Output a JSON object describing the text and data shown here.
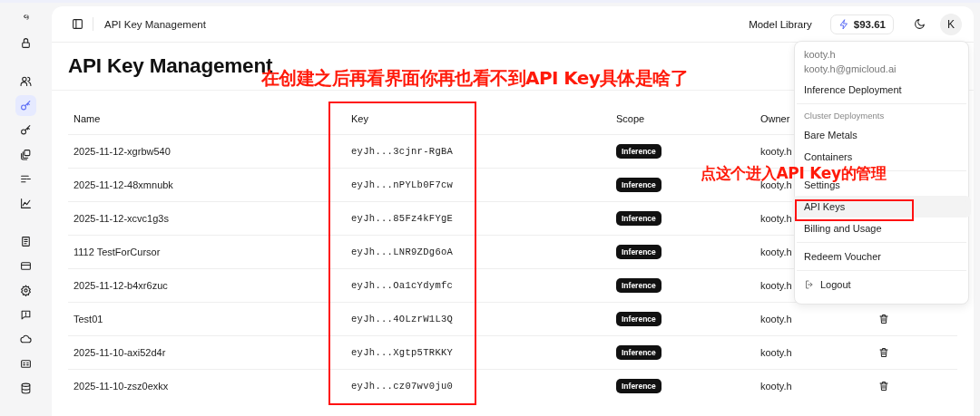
{
  "sidebar": {
    "groups": [
      {
        "items": [
          {
            "selected": false
          }
        ]
      },
      {
        "items": [
          {
            "selected": false
          },
          {
            "selected": true
          },
          {
            "selected": false
          },
          {
            "selected": false
          },
          {
            "selected": false
          },
          {
            "selected": false
          }
        ]
      },
      {
        "items": [
          {
            "selected": false
          },
          {
            "selected": false
          },
          {
            "selected": false
          },
          {
            "selected": false
          },
          {
            "selected": false
          },
          {
            "selected": false
          },
          {
            "selected": false
          }
        ]
      }
    ]
  },
  "header": {
    "title": "API Key Management",
    "link": "Model Library",
    "balance": "$93.61",
    "avatar": "K"
  },
  "page_title": "API Key Management",
  "table": {
    "columns": [
      "Name",
      "Key",
      "Scope",
      "Owner"
    ],
    "rows": [
      {
        "name": "2025-11-12-xgrbw540",
        "key": "eyJh...3cjnr-RgBA",
        "scope": "Inference",
        "owner": "kooty.h",
        "delete_icon": false
      },
      {
        "name": "2025-11-12-48xmnubk",
        "key": "eyJh...nPYLb0F7cw",
        "scope": "Inference",
        "owner": "kooty.h",
        "delete_icon": false
      },
      {
        "name": "2025-11-12-xcvc1g3s",
        "key": "eyJh...85Fz4kFYgE",
        "scope": "Inference",
        "owner": "kooty.h",
        "delete_icon": false
      },
      {
        "name": "1112 TestForCursor",
        "key": "eyJh...LNR9ZDg6oA",
        "scope": "Inference",
        "owner": "kooty.h",
        "delete_icon": false
      },
      {
        "name": "2025-11-12-b4xr6zuc",
        "key": "eyJh...Oa1cYdymfc",
        "scope": "Inference",
        "owner": "kooty.h",
        "delete_icon": false
      },
      {
        "name": "Test01",
        "key": "eyJh...4OLzrW1L3Q",
        "scope": "Inference",
        "owner": "kooty.h",
        "delete_icon": true
      },
      {
        "name": "2025-11-10-axi52d4r",
        "key": "eyJh...Xgtp5TRKKY",
        "scope": "Inference",
        "owner": "kooty.h",
        "delete_icon": true
      },
      {
        "name": "2025-11-10-zsz0exkx",
        "key": "eyJh...cz07wv0ju0",
        "scope": "Inference",
        "owner": "kooty.h",
        "delete_icon": true
      }
    ]
  },
  "user_menu": {
    "username": "kooty.h",
    "email": "kooty.h@gmicloud.ai",
    "sections": [
      {
        "items": [
          {
            "label": "Inference Deployment",
            "kind": "plain",
            "selected": false
          }
        ]
      },
      {
        "heading": "Cluster Deployments",
        "items": [
          {
            "label": "Bare Metals",
            "kind": "plain",
            "selected": false
          },
          {
            "label": "Containers",
            "kind": "plain",
            "selected": false
          }
        ]
      },
      {
        "items": [
          {
            "label": "Settings",
            "kind": "plain",
            "selected": false
          },
          {
            "label": "API Keys",
            "kind": "plain",
            "selected": true
          },
          {
            "label": "Billing and Usage",
            "kind": "plain",
            "selected": false
          }
        ]
      },
      {
        "items": [
          {
            "label": "Redeem Voucher",
            "kind": "plain",
            "selected": false
          }
        ]
      },
      {
        "items": [
          {
            "label": "Logout",
            "kind": "logout",
            "selected": false
          }
        ]
      }
    ]
  },
  "annotations": [
    {
      "kind": "note",
      "text": "在创建之后再看界面你再也看不到API Key具体是啥了"
    },
    {
      "kind": "frame"
    },
    {
      "kind": "note",
      "text": "点这个进入API Key的管理"
    },
    {
      "kind": "frame"
    }
  ]
}
